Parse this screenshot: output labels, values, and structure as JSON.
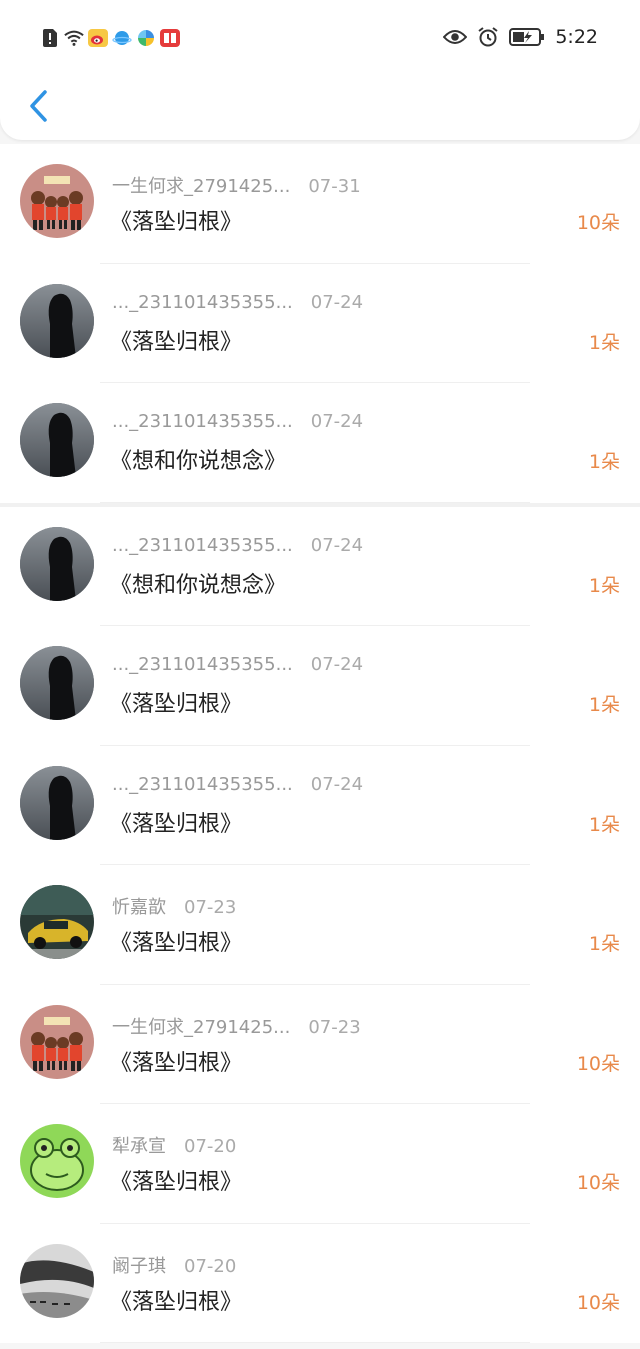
{
  "status_bar": {
    "time": "5:22",
    "left_icons": [
      "alert-icon",
      "wifi-icon",
      "weibo-icon",
      "qq-browser-icon",
      "pinwheel-icon",
      "reader-icon"
    ],
    "right_icons": [
      "eye-icon",
      "alarm-icon",
      "battery-icon"
    ]
  },
  "colors": {
    "accent": "#e8894a",
    "back": "#2f93e3"
  },
  "rows": [
    {
      "name": "一生何求_2791425...",
      "date": "07-31",
      "title": "《落坠归根》",
      "count": "10朵",
      "avatar": "family"
    },
    {
      "name": "..._231101435355...",
      "date": "07-24",
      "title": "《落坠归根》",
      "count": "1朵",
      "avatar": "hood"
    },
    {
      "name": "..._231101435355...",
      "date": "07-24",
      "title": "《想和你说想念》",
      "count": "1朵",
      "avatar": "hood"
    },
    {
      "name": "..._231101435355...",
      "date": "07-24",
      "title": "《想和你说想念》",
      "count": "1朵",
      "avatar": "hood"
    },
    {
      "name": "..._231101435355...",
      "date": "07-24",
      "title": "《落坠归根》",
      "count": "1朵",
      "avatar": "hood"
    },
    {
      "name": "..._231101435355...",
      "date": "07-24",
      "title": "《落坠归根》",
      "count": "1朵",
      "avatar": "hood"
    },
    {
      "name": "忻嘉歆",
      "date": "07-23",
      "title": "《落坠归根》",
      "count": "1朵",
      "avatar": "car"
    },
    {
      "name": "一生何求_2791425...",
      "date": "07-23",
      "title": "《落坠归根》",
      "count": "10朵",
      "avatar": "family"
    },
    {
      "name": "犁承宣",
      "date": "07-20",
      "title": "《落坠归根》",
      "count": "10朵",
      "avatar": "frog"
    },
    {
      "name": "阚子琪",
      "date": "07-20",
      "title": "《落坠归根》",
      "count": "10朵",
      "avatar": "ink"
    }
  ]
}
